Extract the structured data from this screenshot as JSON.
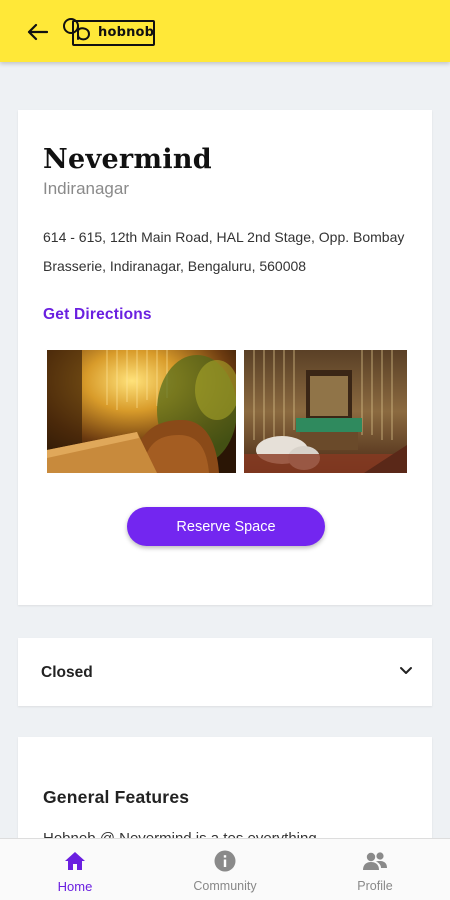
{
  "header": {
    "logo_text": "hobnob",
    "accent": "#ffe838"
  },
  "venue": {
    "name": "Nevermind",
    "area": "Indiranagar",
    "address": "614 - 615, 12th Main Road, HAL 2nd Stage, Opp. Bombay Brasserie, Indiranagar, Bengaluru, 560008",
    "directions_label": "Get Directions",
    "reserve_label": "Reserve Space",
    "accent": "#7326f0"
  },
  "hours": {
    "status": "Closed"
  },
  "features": {
    "title": "General Features",
    "text_partial": "Hobnob @ Nevermind is a tes everything"
  },
  "bottom_nav": {
    "items": [
      {
        "label": "Home",
        "icon": "home-icon",
        "active": true
      },
      {
        "label": "Community",
        "icon": "info-icon",
        "active": false
      },
      {
        "label": "Profile",
        "icon": "people-icon",
        "active": false
      }
    ]
  }
}
